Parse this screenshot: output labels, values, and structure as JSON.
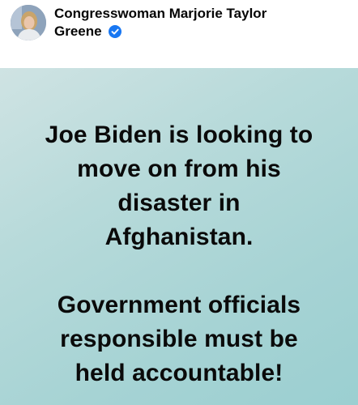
{
  "author": {
    "name_line1": "Congresswoman Marjorie Taylor",
    "name_line2": "Greene",
    "verified": true,
    "accent_color": "#1877f2"
  },
  "post": {
    "paragraph1": [
      "Joe Biden is looking to",
      "move on from his",
      "disaster in",
      "Afghanistan."
    ],
    "paragraph2": [
      "Government officials",
      "responsible must be",
      "held accountable!"
    ],
    "background_colors": [
      "#cfe3e3",
      "#9bcfd1"
    ]
  }
}
